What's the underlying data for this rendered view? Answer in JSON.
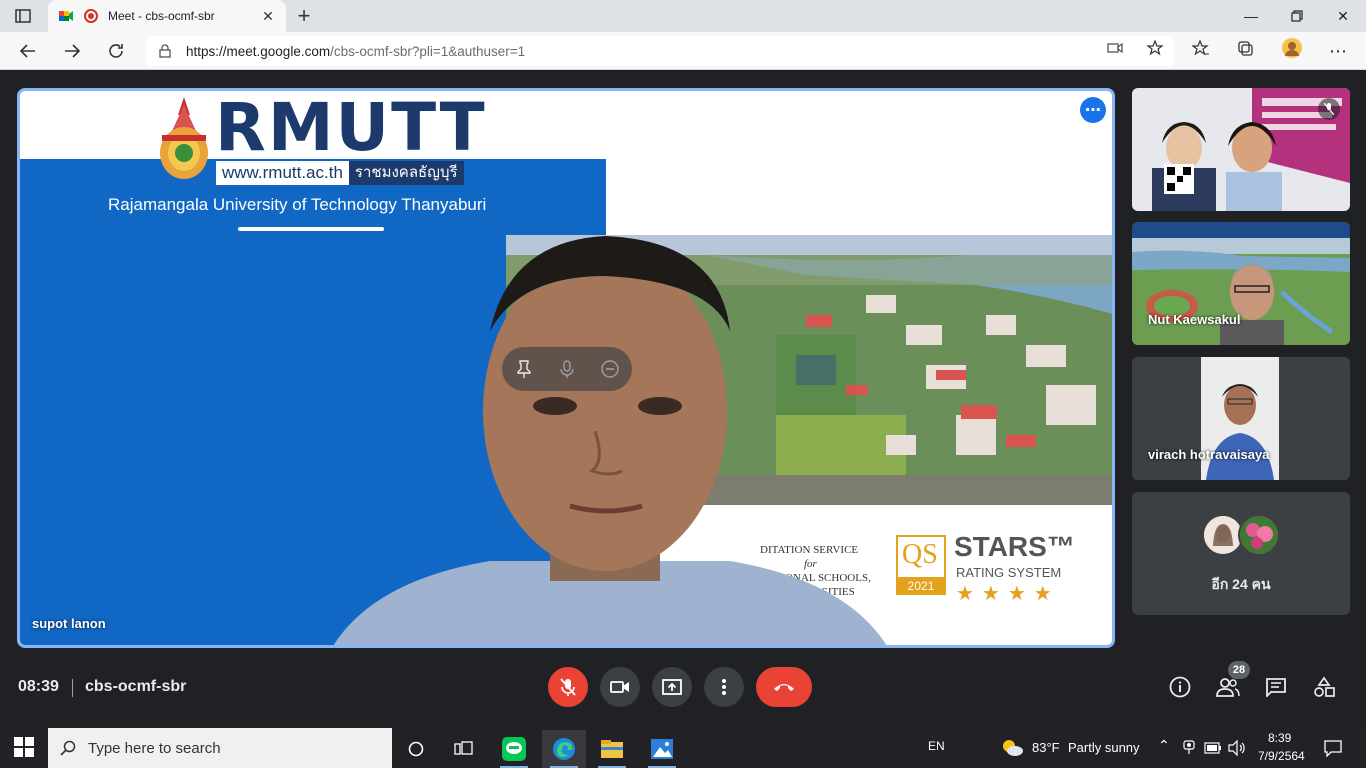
{
  "browser": {
    "tab_title": "Meet - cbs-ocmf-sbr",
    "url_host": "https://meet.google.com",
    "url_path": "/cbs-ocmf-sbr?pli=1&authuser=1"
  },
  "main_tile": {
    "participant_name": "supot lanon",
    "slide": {
      "logo_text": "RMUTT",
      "logo_url": "www.rmutt.ac.th",
      "logo_thai": "ราชมงคลธัญบุรี",
      "university_name": "Rajamangala University of Technology Thanyaburi",
      "accreditation_lines": [
        "DITATION SERVICE",
        "for",
        "NATIONAL SCHOOLS,",
        "S & UNIVERSITIES"
      ],
      "qs_label": "QS",
      "qs_year": "2021",
      "stars_title": "STARS™",
      "stars_subtitle": "RATING SYSTEM",
      "stars": "★★★★"
    }
  },
  "side_tiles": [
    {
      "name": ""
    },
    {
      "name": "Nut Kaewsakul"
    },
    {
      "name": "virach hotravaisaya"
    },
    {
      "name": "อีก 24 คน"
    }
  ],
  "bottom_bar": {
    "time": "08:39",
    "meeting_code": "cbs-ocmf-sbr",
    "participant_count": "28"
  },
  "taskbar": {
    "search_placeholder": "Type here to search",
    "language": "EN",
    "weather_temp": "83°F",
    "weather_desc": "Partly sunny",
    "clock_time": "8:39",
    "clock_date": "7/9/2564"
  },
  "colors": {
    "meet_bg": "#202124",
    "active_border": "#8ab4f8",
    "danger": "#ea4335",
    "slide_blue": "#1167c4"
  }
}
